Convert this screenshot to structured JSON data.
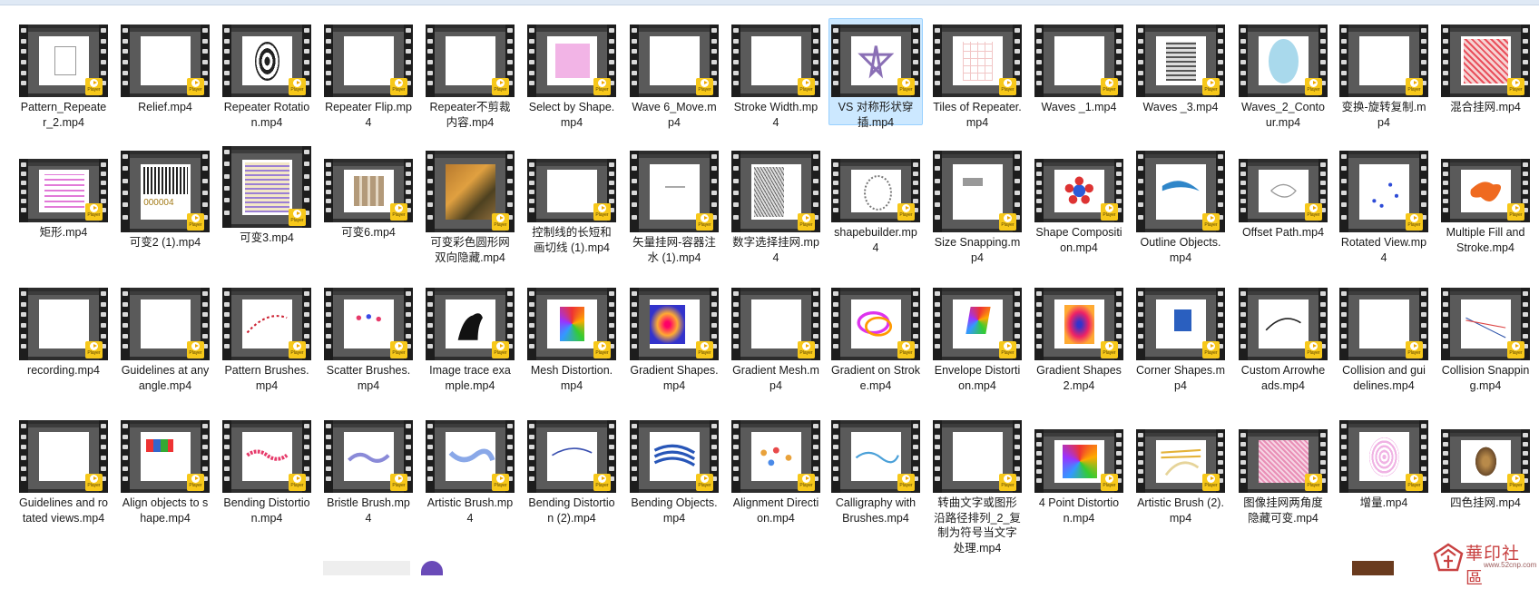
{
  "items": [
    {
      "label": "Pattern_Repeater_2.mp4",
      "selected": false
    },
    {
      "label": "Relief.mp4",
      "selected": false
    },
    {
      "label": "Repeater Rotation.mp4",
      "selected": false
    },
    {
      "label": "Repeater Flip.mp4",
      "selected": false
    },
    {
      "label": "Repeater不剪裁内容.mp4",
      "selected": false
    },
    {
      "label": "Select by Shape.mp4",
      "selected": false
    },
    {
      "label": "Wave 6_Move.mp4",
      "selected": false
    },
    {
      "label": "Stroke Width.mp4",
      "selected": false
    },
    {
      "label": "VS 对称形状穿插.mp4",
      "selected": true
    },
    {
      "label": "Tiles of Repeater.mp4",
      "selected": false
    },
    {
      "label": "Waves _1.mp4",
      "selected": false
    },
    {
      "label": "Waves _3.mp4",
      "selected": false
    },
    {
      "label": "Waves_2_Contour.mp4",
      "selected": false
    },
    {
      "label": "变换-旋转复制.mp4",
      "selected": false
    },
    {
      "label": "混合挂网.mp4",
      "selected": false
    },
    {
      "label": "矩形.mp4",
      "selected": false
    },
    {
      "label": "可变2 (1).mp4",
      "selected": false
    },
    {
      "label": "可变3.mp4",
      "selected": false
    },
    {
      "label": "可变6.mp4",
      "selected": false
    },
    {
      "label": "可变彩色圆形网双向隐藏.mp4",
      "selected": false
    },
    {
      "label": "控制线的长短和画切线 (1).mp4",
      "selected": false
    },
    {
      "label": "矢量挂网-容器注水 (1).mp4",
      "selected": false
    },
    {
      "label": "数字选择挂网.mp4",
      "selected": false
    },
    {
      "label": "shapebuilder.mp4",
      "selected": false
    },
    {
      "label": "Size Snapping.mp4",
      "selected": false
    },
    {
      "label": "Shape Composition.mp4",
      "selected": false
    },
    {
      "label": "Outline Objects.mp4",
      "selected": false
    },
    {
      "label": "Offset Path.mp4",
      "selected": false
    },
    {
      "label": "Rotated View.mp4",
      "selected": false
    },
    {
      "label": "Multiple Fill and Stroke.mp4",
      "selected": false
    },
    {
      "label": "recording.mp4",
      "selected": false
    },
    {
      "label": "Guidelines at any angle.mp4",
      "selected": false
    },
    {
      "label": "Pattern Brushes.mp4",
      "selected": false
    },
    {
      "label": "Scatter Brushes.mp4",
      "selected": false
    },
    {
      "label": "Image trace example.mp4",
      "selected": false
    },
    {
      "label": "Mesh Distortion.mp4",
      "selected": false
    },
    {
      "label": "Gradient Shapes.mp4",
      "selected": false
    },
    {
      "label": "Gradient Mesh.mp4",
      "selected": false
    },
    {
      "label": "Gradient on Stroke.mp4",
      "selected": false
    },
    {
      "label": "Envelope Distortion.mp4",
      "selected": false
    },
    {
      "label": "Gradient Shapes 2.mp4",
      "selected": false
    },
    {
      "label": "Corner Shapes.mp4",
      "selected": false
    },
    {
      "label": "Custom Arrowheads.mp4",
      "selected": false
    },
    {
      "label": "Collision and guidelines.mp4",
      "selected": false
    },
    {
      "label": "Collision Snapping.mp4",
      "selected": false
    },
    {
      "label": "Guidelines and rotated views.mp4",
      "selected": false
    },
    {
      "label": "Align objects to shape.mp4",
      "selected": false
    },
    {
      "label": "Bending Distortion.mp4",
      "selected": false
    },
    {
      "label": "Bristle Brush.mp4",
      "selected": false
    },
    {
      "label": "Artistic Brush.mp4",
      "selected": false
    },
    {
      "label": "Bending Distortion (2).mp4",
      "selected": false
    },
    {
      "label": "Bending Objects.mp4",
      "selected": false
    },
    {
      "label": "Alignment Direction.mp4",
      "selected": false
    },
    {
      "label": "Calligraphy with Brushes.mp4",
      "selected": false
    },
    {
      "label": "转曲文字或图形沿路径排列_2_复制为符号当文字处理.mp4",
      "selected": false
    },
    {
      "label": "4 Point Distortion.mp4",
      "selected": false
    },
    {
      "label": "Artistic Brush (2).mp4",
      "selected": false
    },
    {
      "label": "图像挂网两角度隐藏可变.mp4",
      "selected": false
    },
    {
      "label": "增量.mp4",
      "selected": false
    },
    {
      "label": "四色挂网.mp4",
      "selected": false
    }
  ],
  "badge_text": "Player",
  "watermark": {
    "text": "華印社區",
    "url": "www.52cnp.com"
  },
  "colors": {
    "selection_bg": "#cce8ff",
    "selection_border": "#99d1ff",
    "badge": "#f7c81a",
    "film": "#1d1d1d"
  }
}
